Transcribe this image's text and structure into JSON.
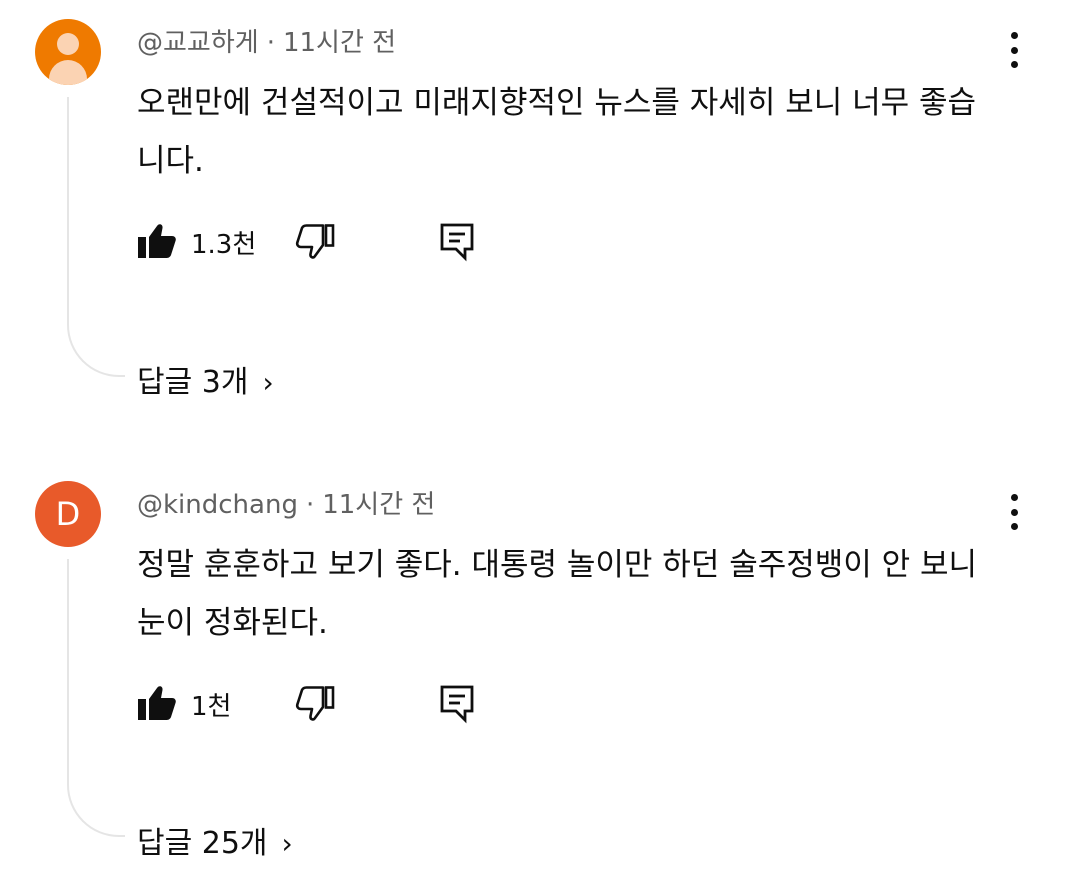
{
  "comments": [
    {
      "author": "@교교하게",
      "time": "11시간 전",
      "separator": "·",
      "text": "오랜만에 건설적이고 미래지향적인 뉴스를 자세히 보니 너무 좋습니다.",
      "likes": "1.3천",
      "replies": "답글 3개",
      "avatar": {
        "type": "person-icon",
        "color": "#ef7a00"
      }
    },
    {
      "author": "@kindchang",
      "time": "11시간 전",
      "separator": "·",
      "text": "정말 훈훈하고 보기 좋다. 대통령 놀이만 하던 술주정뱅이 안 보니 눈이 정화된다.",
      "likes": "1천",
      "replies": "답글 25개",
      "avatar": {
        "type": "letter",
        "letter": "D",
        "color": "#e85a2a"
      }
    }
  ],
  "icons": {
    "like": "thumb-up-filled-icon",
    "dislike": "thumb-down-outline-icon",
    "reply": "comment-reply-icon",
    "more": "more-vertical-icon",
    "expand": "chevron-right-icon"
  },
  "chevron": "›"
}
